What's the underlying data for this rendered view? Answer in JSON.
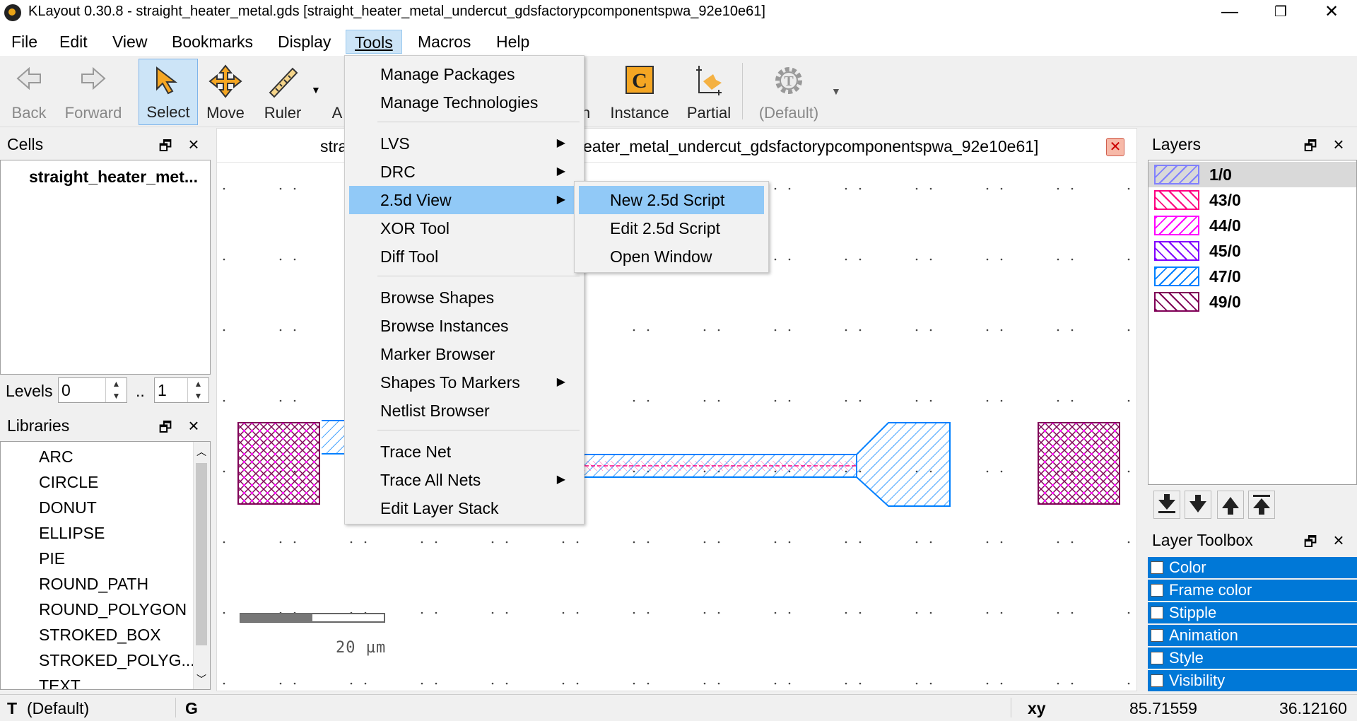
{
  "window": {
    "title": "KLayout 0.30.8 - straight_heater_metal.gds [straight_heater_metal_undercut_gdsfactorypcomponentspwa_92e10e61]",
    "controls": {
      "minimize": "—",
      "restore": "❐",
      "close": "✕"
    }
  },
  "menubar": [
    "File",
    "Edit",
    "View",
    "Bookmarks",
    "Display",
    "Tools",
    "Macros",
    "Help"
  ],
  "toolbar": {
    "back": "Back",
    "forward": "Forward",
    "select": "Select",
    "move": "Move",
    "ruler": "Ruler",
    "partial_a": "A",
    "partial_h": "h",
    "instance": "Instance",
    "partial": "Partial",
    "default": "(Default)"
  },
  "cells": {
    "title": "Cells",
    "items": [
      "straight_heater_met..."
    ],
    "levels_label": "Levels",
    "levels_from": "0",
    "levels_sep": "..",
    "levels_to": "1"
  },
  "libraries": {
    "title": "Libraries",
    "items": [
      "ARC",
      "CIRCLE",
      "DONUT",
      "ELLIPSE",
      "PIE",
      "ROUND_PATH",
      "ROUND_POLYGON",
      "STROKED_BOX",
      "STROKED_POLYG...",
      "TEXT"
    ]
  },
  "canvas": {
    "tab_prefix": "stra",
    "tab_suffix": "eater_metal_undercut_gdsfactorypcomponentspwa_92e10e61]",
    "scale_label": "20 µm"
  },
  "tools_menu": {
    "items": [
      {
        "label": "Manage Packages"
      },
      {
        "label": "Manage Technologies"
      },
      {
        "label": "LVS",
        "sub": true
      },
      {
        "label": "DRC",
        "sub": true
      },
      {
        "label": "2.5d View",
        "sub": true
      },
      {
        "label": "XOR Tool"
      },
      {
        "label": "Diff Tool"
      },
      {
        "label": "Browse Shapes"
      },
      {
        "label": "Browse Instances"
      },
      {
        "label": "Marker Browser"
      },
      {
        "label": "Shapes To Markers",
        "sub": true
      },
      {
        "label": "Netlist Browser"
      },
      {
        "label": "Trace Net"
      },
      {
        "label": "Trace All Nets",
        "sub": true
      },
      {
        "label": "Edit Layer Stack"
      }
    ]
  },
  "submenu_2_5d": [
    "New 2.5d Script",
    "Edit 2.5d Script",
    "Open Window"
  ],
  "layers": {
    "title": "Layers",
    "items": [
      {
        "name": "1/0",
        "color": "#8080ff"
      },
      {
        "name": "43/0",
        "color": "#ff0080"
      },
      {
        "name": "44/0",
        "color": "#ff00ff"
      },
      {
        "name": "45/0",
        "color": "#8000ff"
      },
      {
        "name": "47/0",
        "color": "#0080ff"
      },
      {
        "name": "49/0",
        "color": "#800057"
      }
    ]
  },
  "layer_toolbox": {
    "title": "Layer Toolbox",
    "items": [
      "Color",
      "Frame color",
      "Stipple",
      "Animation",
      "Style",
      "Visibility"
    ]
  },
  "status": {
    "t": "T",
    "default": "(Default)",
    "g": "G",
    "xy": "xy",
    "x": "85.71559",
    "y": "36.12160"
  }
}
